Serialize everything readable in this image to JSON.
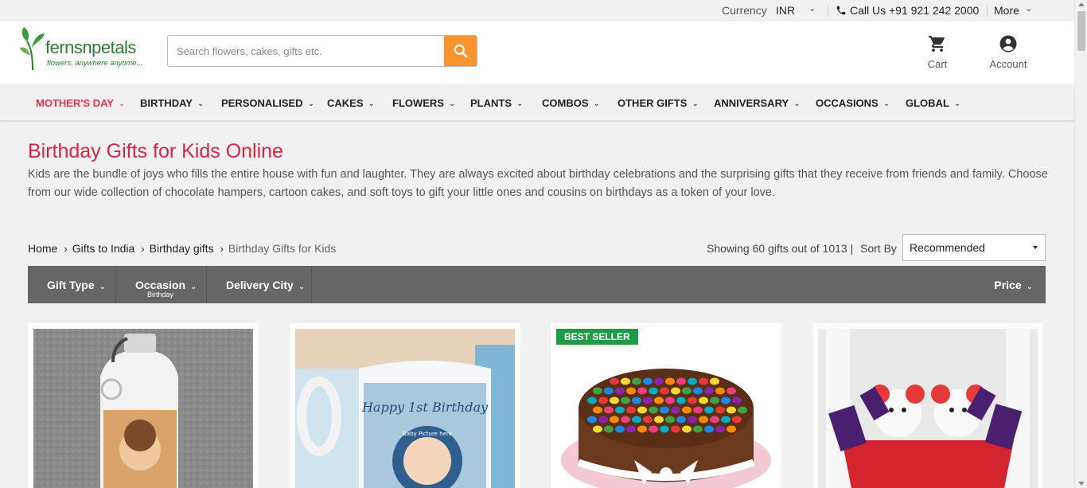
{
  "topbar": {
    "currency_label": "Currency",
    "currency_value": "INR",
    "call_text": "Call Us +91 921 242 2000",
    "more_label": "More"
  },
  "header": {
    "logo_brand": "fernsnpetals",
    "logo_tagline": "flowers, anywhere anytime...",
    "search_placeholder": "Search flowers, cakes, gifts etc.",
    "cart_label": "Cart",
    "account_label": "Account"
  },
  "nav": {
    "items": [
      {
        "label": "MOTHER'S DAY"
      },
      {
        "label": "BIRTHDAY"
      },
      {
        "label": "PERSONALISED"
      },
      {
        "label": "CAKES"
      },
      {
        "label": "FLOWERS"
      },
      {
        "label": "PLANTS"
      },
      {
        "label": "COMBOS"
      },
      {
        "label": "OTHER GIFTS"
      },
      {
        "label": "ANNIVERSARY"
      },
      {
        "label": "OCCASIONS"
      },
      {
        "label": "GLOBAL"
      }
    ]
  },
  "intro": {
    "title": "Birthday Gifts for Kids Online",
    "description": "Kids are the bundle of joys who fills the entire house with fun and laughter. They are always excited about birthday celebrations and the surprising gifts that they receive from friends and family. Choose from our wide collection of chocolate hampers, cartoon cakes, and soft toys to gift your little ones and cousins on birthdays as a token of your love."
  },
  "breadcrumb": [
    "Home",
    "Gifts to India",
    "Birthday gifts",
    "Birthday Gifts for Kids"
  ],
  "results": {
    "showing_text": "Showing 60 gifts out of 1013 |",
    "sort_label": "Sort By",
    "sort_value": "Recommended"
  },
  "filters": {
    "gift_type": "Gift Type",
    "occasion": "Occasion",
    "occasion_selected": "Birthday",
    "delivery_city": "Delivery City",
    "price": "Price"
  },
  "products": {
    "badge": "BEST SELLER",
    "mug_text": "Happy 1st Birthday",
    "mug_sub": "Baby Picture here"
  },
  "colors": {
    "brand_green": "#2e7d32",
    "accent_orange": "#f9932e",
    "title_red": "#d32744",
    "badge_green": "#1e9b45",
    "filter_bar": "#666666"
  }
}
